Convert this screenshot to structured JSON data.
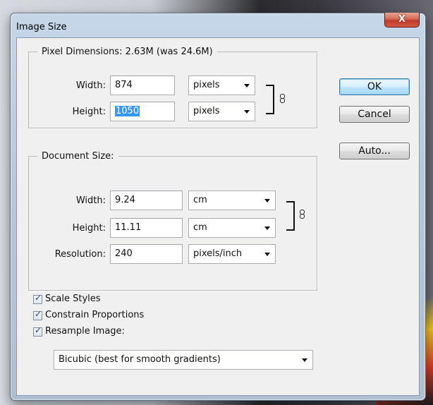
{
  "window": {
    "title": "Image Size",
    "close_label": "X"
  },
  "pixel_dimensions": {
    "legend": "Pixel Dimensions:  2.63M (was 24.6M)",
    "width_label": "Width:",
    "width_value": "874",
    "width_unit": "pixels",
    "height_label": "Height:",
    "height_value": "1050",
    "height_unit": "pixels"
  },
  "document_size": {
    "legend": "Document Size:",
    "width_label": "Width:",
    "width_value": "9.24",
    "width_unit": "cm",
    "height_label": "Height:",
    "height_value": "11.11",
    "height_unit": "cm",
    "resolution_label": "Resolution:",
    "resolution_value": "240",
    "resolution_unit": "pixels/inch"
  },
  "buttons": {
    "ok": "OK",
    "cancel": "Cancel",
    "auto": "Auto..."
  },
  "options": {
    "scale_styles": {
      "label": "Scale Styles",
      "checked": true
    },
    "constrain_proportions": {
      "label": "Constrain Proportions",
      "checked": true
    },
    "resample_image": {
      "label": "Resample Image:",
      "checked": true
    },
    "resample_method": "Bicubic (best for smooth gradients)"
  },
  "icons": {
    "chain": "chain-link-icon",
    "dropdown": "chevron-down-icon",
    "check": "checkmark-icon"
  }
}
